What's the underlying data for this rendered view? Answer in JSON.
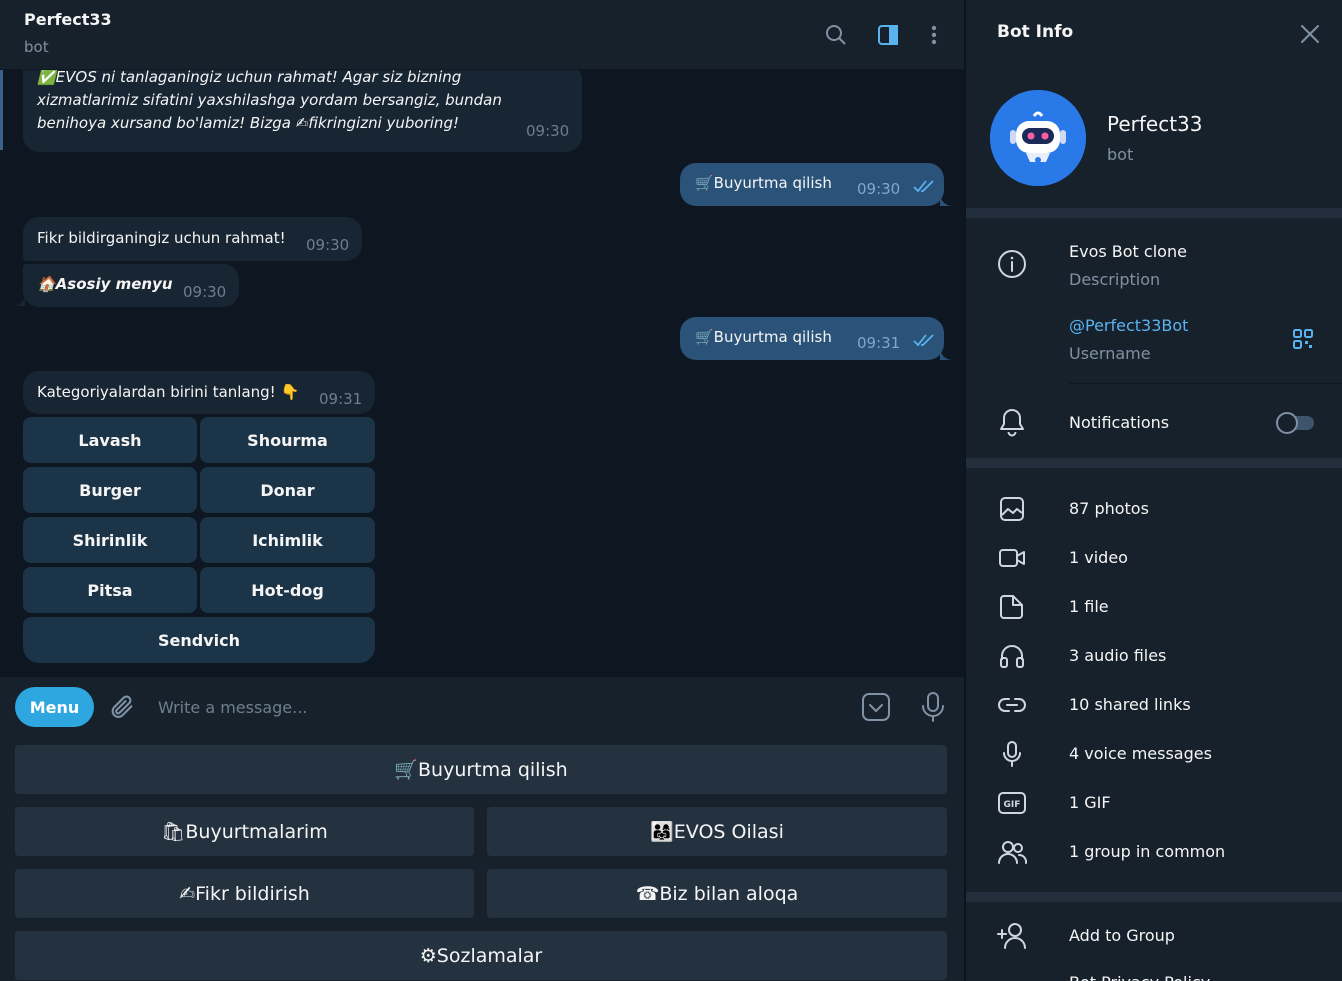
{
  "chat": {
    "title": "Perfect33",
    "subtitle": "bot"
  },
  "messages": {
    "first_in": {
      "line1": "✅EVOS ni tanlaganingiz uchun rahmat! Agar siz bizning",
      "line2": "xizmatlarimiz sifatini yaxshilashga yordam bersangiz, bundan",
      "line3": "benihoya xursand bo'lamiz! Bizga ✍fikringizni yuboring!",
      "time": "09:30"
    },
    "out1": {
      "text": "🛒Buyurtma qilish",
      "time": "09:30"
    },
    "in2": {
      "text": "Fikr bildirganingiz uchun rahmat!",
      "time": "09:30"
    },
    "in3": {
      "text": "🏠Asosiy menyu",
      "time": "09:30"
    },
    "out2": {
      "text": "🛒Buyurtma qilish",
      "time": "09:31"
    },
    "in4": {
      "text": "Kategoriyalardan birini tanlang! 👇",
      "time": "09:31"
    }
  },
  "inline_keyboard": [
    "Lavash",
    "Shourma",
    "Burger",
    "Donar",
    "Shirinlik",
    "Ichimlik",
    "Pitsa",
    "Hot-dog",
    "Sendvich"
  ],
  "composer": {
    "menu_label": "Menu",
    "placeholder": "Write a message..."
  },
  "reply_keyboard": [
    "🛒Buyurtma qilish",
    "🛍Buyurtmalarim",
    "👨‍👩‍👧EVOS Oilasi",
    "✍Fikr bildirish",
    "☎Biz bilan aloqa",
    "⚙Sozlamalar"
  ],
  "info": {
    "header": "Bot Info",
    "name": "Perfect33",
    "status": "bot",
    "description": "Evos Bot clone",
    "description_label": "Description",
    "username": "@Perfect33Bot",
    "username_label": "Username",
    "notifications_label": "Notifications",
    "notifications_on": false,
    "media": [
      "87 photos",
      "1 video",
      "1 file",
      "3 audio files",
      "10 shared links",
      "4 voice messages",
      "1 GIF",
      "1 group in common"
    ],
    "add_to_group": "Add to Group",
    "privacy_policy": "Bot Privacy Policy"
  },
  "colors": {
    "accent": "#2ea6e0",
    "chat_bg": "#0e1621",
    "panel_bg": "#17212b",
    "outgoing_bubble": "#2b5278",
    "incoming_bubble": "#182533"
  },
  "icons": [
    "search-icon",
    "sidebar-toggle-icon",
    "more-vertical-icon",
    "close-icon",
    "paperclip-icon",
    "keyboard-toggle-icon",
    "microphone-icon",
    "info-icon",
    "qr-code-icon",
    "bell-icon",
    "photo-icon",
    "video-icon",
    "file-icon",
    "headphones-icon",
    "link-icon",
    "voice-icon",
    "gif-icon",
    "group-icon",
    "add-user-icon"
  ]
}
